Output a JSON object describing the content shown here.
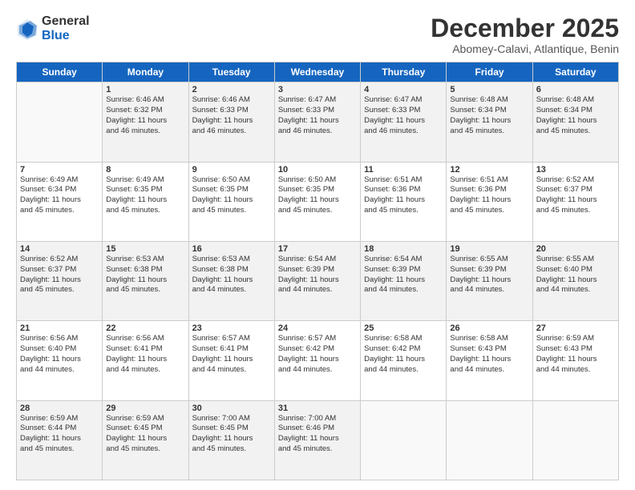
{
  "logo": {
    "general": "General",
    "blue": "Blue"
  },
  "header": {
    "month": "December 2025",
    "location": "Abomey-Calavi, Atlantique, Benin"
  },
  "days": [
    "Sunday",
    "Monday",
    "Tuesday",
    "Wednesday",
    "Thursday",
    "Friday",
    "Saturday"
  ],
  "weeks": [
    [
      {
        "date": "",
        "info": ""
      },
      {
        "date": "1",
        "info": "Sunrise: 6:46 AM\nSunset: 6:32 PM\nDaylight: 11 hours\nand 46 minutes."
      },
      {
        "date": "2",
        "info": "Sunrise: 6:46 AM\nSunset: 6:33 PM\nDaylight: 11 hours\nand 46 minutes."
      },
      {
        "date": "3",
        "info": "Sunrise: 6:47 AM\nSunset: 6:33 PM\nDaylight: 11 hours\nand 46 minutes."
      },
      {
        "date": "4",
        "info": "Sunrise: 6:47 AM\nSunset: 6:33 PM\nDaylight: 11 hours\nand 46 minutes."
      },
      {
        "date": "5",
        "info": "Sunrise: 6:48 AM\nSunset: 6:34 PM\nDaylight: 11 hours\nand 45 minutes."
      },
      {
        "date": "6",
        "info": "Sunrise: 6:48 AM\nSunset: 6:34 PM\nDaylight: 11 hours\nand 45 minutes."
      }
    ],
    [
      {
        "date": "7",
        "info": "Sunrise: 6:49 AM\nSunset: 6:34 PM\nDaylight: 11 hours\nand 45 minutes."
      },
      {
        "date": "8",
        "info": "Sunrise: 6:49 AM\nSunset: 6:35 PM\nDaylight: 11 hours\nand 45 minutes."
      },
      {
        "date": "9",
        "info": "Sunrise: 6:50 AM\nSunset: 6:35 PM\nDaylight: 11 hours\nand 45 minutes."
      },
      {
        "date": "10",
        "info": "Sunrise: 6:50 AM\nSunset: 6:35 PM\nDaylight: 11 hours\nand 45 minutes."
      },
      {
        "date": "11",
        "info": "Sunrise: 6:51 AM\nSunset: 6:36 PM\nDaylight: 11 hours\nand 45 minutes."
      },
      {
        "date": "12",
        "info": "Sunrise: 6:51 AM\nSunset: 6:36 PM\nDaylight: 11 hours\nand 45 minutes."
      },
      {
        "date": "13",
        "info": "Sunrise: 6:52 AM\nSunset: 6:37 PM\nDaylight: 11 hours\nand 45 minutes."
      }
    ],
    [
      {
        "date": "14",
        "info": "Sunrise: 6:52 AM\nSunset: 6:37 PM\nDaylight: 11 hours\nand 45 minutes."
      },
      {
        "date": "15",
        "info": "Sunrise: 6:53 AM\nSunset: 6:38 PM\nDaylight: 11 hours\nand 45 minutes."
      },
      {
        "date": "16",
        "info": "Sunrise: 6:53 AM\nSunset: 6:38 PM\nDaylight: 11 hours\nand 44 minutes."
      },
      {
        "date": "17",
        "info": "Sunrise: 6:54 AM\nSunset: 6:39 PM\nDaylight: 11 hours\nand 44 minutes."
      },
      {
        "date": "18",
        "info": "Sunrise: 6:54 AM\nSunset: 6:39 PM\nDaylight: 11 hours\nand 44 minutes."
      },
      {
        "date": "19",
        "info": "Sunrise: 6:55 AM\nSunset: 6:39 PM\nDaylight: 11 hours\nand 44 minutes."
      },
      {
        "date": "20",
        "info": "Sunrise: 6:55 AM\nSunset: 6:40 PM\nDaylight: 11 hours\nand 44 minutes."
      }
    ],
    [
      {
        "date": "21",
        "info": "Sunrise: 6:56 AM\nSunset: 6:40 PM\nDaylight: 11 hours\nand 44 minutes."
      },
      {
        "date": "22",
        "info": "Sunrise: 6:56 AM\nSunset: 6:41 PM\nDaylight: 11 hours\nand 44 minutes."
      },
      {
        "date": "23",
        "info": "Sunrise: 6:57 AM\nSunset: 6:41 PM\nDaylight: 11 hours\nand 44 minutes."
      },
      {
        "date": "24",
        "info": "Sunrise: 6:57 AM\nSunset: 6:42 PM\nDaylight: 11 hours\nand 44 minutes."
      },
      {
        "date": "25",
        "info": "Sunrise: 6:58 AM\nSunset: 6:42 PM\nDaylight: 11 hours\nand 44 minutes."
      },
      {
        "date": "26",
        "info": "Sunrise: 6:58 AM\nSunset: 6:43 PM\nDaylight: 11 hours\nand 44 minutes."
      },
      {
        "date": "27",
        "info": "Sunrise: 6:59 AM\nSunset: 6:43 PM\nDaylight: 11 hours\nand 44 minutes."
      }
    ],
    [
      {
        "date": "28",
        "info": "Sunrise: 6:59 AM\nSunset: 6:44 PM\nDaylight: 11 hours\nand 45 minutes."
      },
      {
        "date": "29",
        "info": "Sunrise: 6:59 AM\nSunset: 6:45 PM\nDaylight: 11 hours\nand 45 minutes."
      },
      {
        "date": "30",
        "info": "Sunrise: 7:00 AM\nSunset: 6:45 PM\nDaylight: 11 hours\nand 45 minutes."
      },
      {
        "date": "31",
        "info": "Sunrise: 7:00 AM\nSunset: 6:46 PM\nDaylight: 11 hours\nand 45 minutes."
      },
      {
        "date": "",
        "info": ""
      },
      {
        "date": "",
        "info": ""
      },
      {
        "date": "",
        "info": ""
      }
    ]
  ]
}
